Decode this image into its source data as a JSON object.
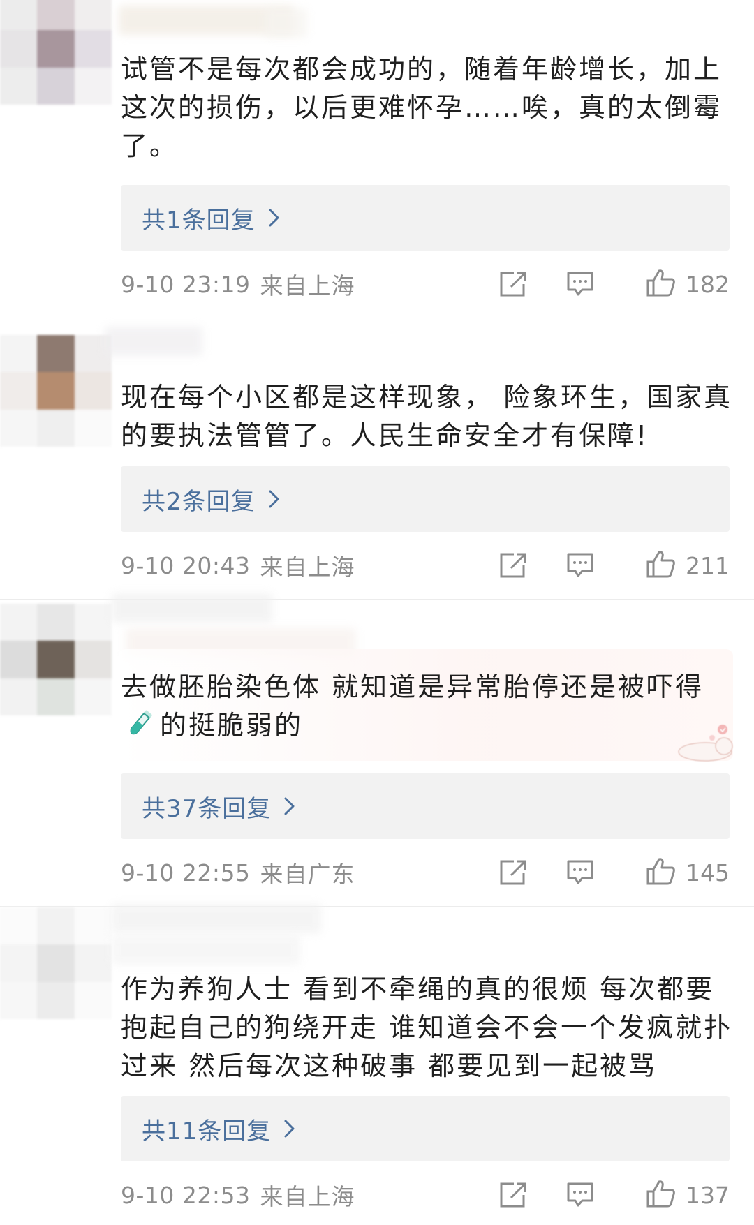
{
  "comments": [
    {
      "text": "试管不是每次都会成功的，随着年龄增长，加上这次的损伤，以后更难怀孕……唉，真的太倒霉了。",
      "reply_label": "共1条回复",
      "time": "9-10 23:19",
      "location": "来自上海",
      "likes": "182"
    },
    {
      "text": "现在每个小区都是这样现象， 险象环生，国家真的要执法管管了。人民生命安全才有保障!",
      "reply_label": "共2条回复",
      "time": "9-10 20:43",
      "location": "来自上海",
      "likes": "211"
    },
    {
      "text_before_emoji": "去做胚胎染色体 就知道是异常胎停还是被吓得 ",
      "text_after_emoji": "的挺脆弱的",
      "emoji": "test-tube-icon",
      "reply_label": "共37条回复",
      "time": "9-10 22:55",
      "location": "来自广东",
      "likes": "145"
    },
    {
      "text": "作为养狗人士 看到不牵绳的真的很烦 每次都要抱起自己的狗绕开走 谁知道会不会一个发疯就扑过来 然后每次这种破事 都要见到一起被骂",
      "reply_label": "共11条回复",
      "time": "9-10 22:53",
      "location": "来自上海",
      "likes": "137"
    }
  ],
  "icons": {
    "share": "share-icon",
    "comment": "comment-icon",
    "like": "thumbs-up-icon",
    "chevron": "chevron-right-icon"
  },
  "colors": {
    "reply_link": "#4a6f9c",
    "reply_bg": "#f2f2f2",
    "meta_text": "#8c8c8c",
    "body_text": "#1f1f1f"
  }
}
